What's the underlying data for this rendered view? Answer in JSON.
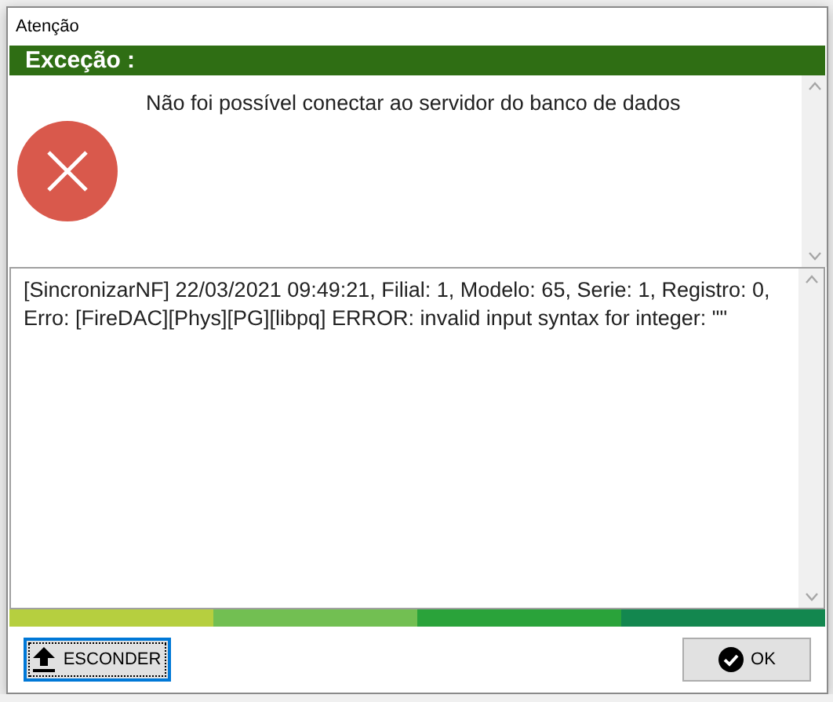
{
  "window": {
    "title": "Atenção"
  },
  "header": "Exceção :",
  "message": "Não foi possível conectar ao servidor do banco de dados",
  "details": "[SincronizarNF] 22/03/2021 09:49:21, Filial: 1, Modelo: 65, Serie: 1, Registro: 0, Erro: [FireDAC][Phys][PG][libpq] ERROR: invalid input syntax for integer: \"\"",
  "buttons": [
    {
      "label": "ESCONDER",
      "kind": "hide",
      "focused": true
    },
    {
      "label": "OK",
      "kind": "ok",
      "focused": false
    }
  ]
}
